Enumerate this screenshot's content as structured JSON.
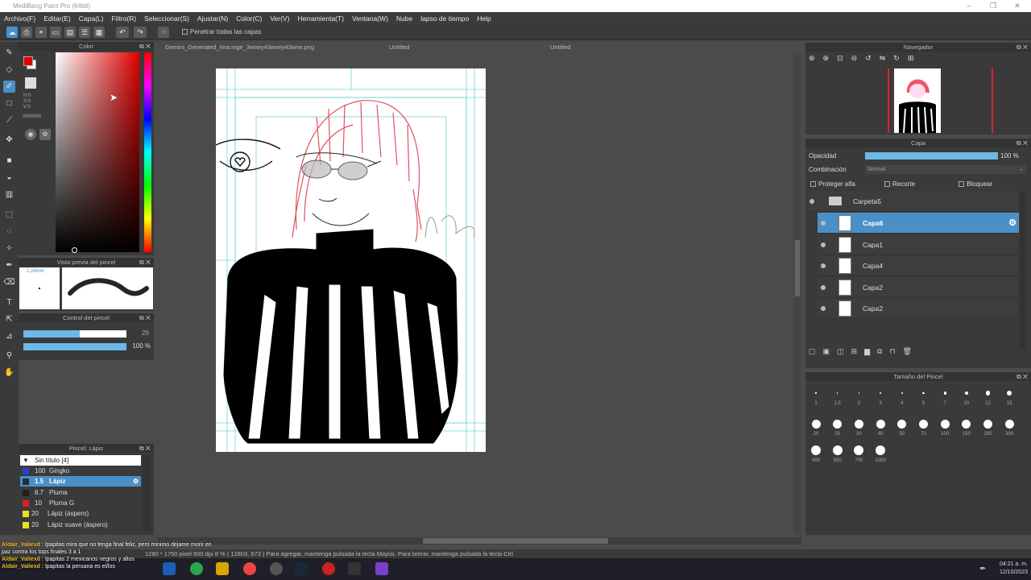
{
  "window": {
    "title": "MediBang Paint Pro (64bit)"
  },
  "menu": [
    "Archivo(F)",
    "Editar(E)",
    "Capa(L)",
    "Filtro(R)",
    "Seleccionar(S)",
    "Ajustar(N)",
    "Color(C)",
    "Ver(V)",
    "Herramienta(T)",
    "Ventana(W)",
    "Nube",
    "lapso de tiempo",
    "Help"
  ],
  "toolbar": {
    "penetrate_label": "Penetrar todas las capas"
  },
  "tabs": [
    "Gemini_Generated_Ima.mge_3wney43wney43wne.png",
    "Untitled",
    "Untitled"
  ],
  "color_panel": {
    "title": "Color",
    "h": "H:0",
    "s": "S:0",
    "v": "V:0",
    "hex": "#000000",
    "fg": "#e00000",
    "bg": "#ffffff"
  },
  "brush_preview": {
    "title": "Vista previa del pincel",
    "size": "1.24mm"
  },
  "brush_control": {
    "title": "Control del pincel",
    "size": "29",
    "opacity": "100 %",
    "size_fraction": 0.55,
    "opacity_fraction": 1.0
  },
  "brush_list": {
    "title": "Pincel: Lápiz",
    "group": "Sin título [4]",
    "items": [
      {
        "size": "100",
        "name": "Gingko",
        "color": "#3040d0",
        "selected": false
      },
      {
        "size": "1.5",
        "name": "Lápiz",
        "color": "#203040",
        "selected": true
      },
      {
        "size": "8.7",
        "name": "Pluma",
        "color": "#202020",
        "selected": false
      },
      {
        "size": "10",
        "name": "Pluma G",
        "color": "#e02020",
        "selected": false
      },
      {
        "size": "20",
        "name": "Lápiz (áspero)",
        "color": "#e8e020",
        "selected": false
      },
      {
        "size": "20",
        "name": "Lápiz suave (áspero)",
        "color": "#e8e020",
        "selected": false
      }
    ]
  },
  "navigator": {
    "title": "Navegador"
  },
  "layer_panel": {
    "title": "Capa",
    "opacity_label": "Opacidad",
    "opacity_value": "100 %",
    "blend_label": "Combinación",
    "blend_value": "Normal",
    "protect_alpha": "Proteger alfa",
    "clipping": "Recorte",
    "lock": "Bloquear",
    "folder": "Carpeta5",
    "layers": [
      {
        "name": "Capa6",
        "selected": true
      },
      {
        "name": "Capa1",
        "selected": false
      },
      {
        "name": "Capa4",
        "selected": false
      },
      {
        "name": "Capa2",
        "selected": false
      },
      {
        "name": "Capa2",
        "selected": false
      }
    ]
  },
  "brush_size_panel": {
    "title": "Tamaño del Pincel",
    "sizes": [
      "1",
      "1.5",
      "2",
      "3",
      "4",
      "5",
      "7",
      "10",
      "12",
      "15",
      "20",
      "25",
      "30",
      "40",
      "50",
      "70",
      "100",
      "150",
      "200",
      "300",
      "400",
      "500",
      "700",
      "1000"
    ]
  },
  "status": {
    "text": "1280 * 1750 pixel    600 dpi   8 %   ( 12803, 673 )   Para agregar, mantenga pulsada la tecla Mayús. Para borrar, mantenga pulsada la tecla Ctrl"
  },
  "chat": [
    {
      "user": "Aldair_Valiexd :",
      "msg": "lpapitas mira que no tenga final feliz, pero minimo dejame morir en"
    },
    {
      "user": "",
      "msg": "paz contra los tops finales 3 a 1"
    },
    {
      "user": "Aldair_Valiexd :",
      "msg": "lpapitas 2 mexicanos negros y altos"
    },
    {
      "user": "Aldair_Valiexd :",
      "msg": "lpapitas la peruana es el/los"
    }
  ],
  "clock": {
    "time": "04:21 a. m.",
    "date": "12/10/2023"
  }
}
